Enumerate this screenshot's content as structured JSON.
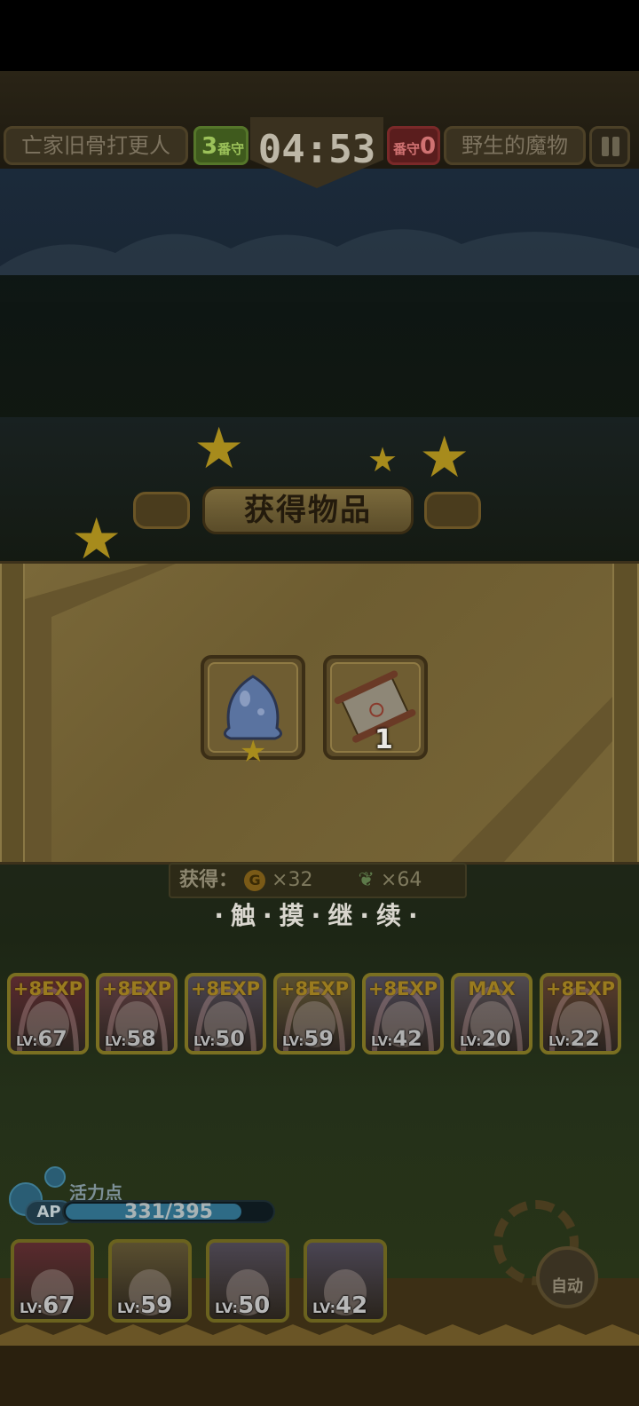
{
  "hud": {
    "left_team_name": "亡家旧骨打更人",
    "left_score": "3",
    "left_score_suffix": "番守",
    "timer": "04:53",
    "right_score_prefix": "番守",
    "right_score": "0",
    "right_team_name": "野生的魔物"
  },
  "dialog": {
    "title": "获得物品",
    "items": [
      {
        "icon": "blue-slime-icon",
        "star": "★"
      },
      {
        "icon": "scroll-icon",
        "count": "1"
      }
    ],
    "reward_label": "获得：",
    "gold_icon": "G",
    "gold_amount": "×32",
    "feather_icon": "❦",
    "feather_amount": "×64",
    "continue_text": "·触·摸·继·续·"
  },
  "party": [
    {
      "exp": "+8EXP",
      "level": "67",
      "lv_label": "LV:",
      "bg": "#5a2a2e"
    },
    {
      "exp": "+8EXP",
      "level": "58",
      "lv_label": "LV:",
      "bg": "#5d3c3f"
    },
    {
      "exp": "+8EXP",
      "level": "50",
      "lv_label": "LV:",
      "bg": "#4b4550"
    },
    {
      "exp": "+8EXP",
      "level": "59",
      "lv_label": "LV:",
      "bg": "#5a4f30"
    },
    {
      "exp": "+8EXP",
      "level": "42",
      "lv_label": "LV:",
      "bg": "#4a4553"
    },
    {
      "exp": "MAX",
      "level": "20",
      "lv_label": "LV:",
      "bg": "#514a50"
    },
    {
      "exp": "+8EXP",
      "level": "22",
      "lv_label": "LV:",
      "bg": "#5a3e2c"
    }
  ],
  "ap": {
    "title": "活力点",
    "badge": "AP",
    "value": "331/395",
    "fill": 0.838
  },
  "team": [
    {
      "level": "67",
      "lv_label": "LV:",
      "bg": "#5a2a2e"
    },
    {
      "level": "59",
      "lv_label": "LV:",
      "bg": "#5a4f30"
    },
    {
      "level": "50",
      "lv_label": "LV:",
      "bg": "#4b4550"
    },
    {
      "level": "42",
      "lv_label": "LV:",
      "bg": "#4a4553"
    }
  ],
  "auto_label": "自动"
}
